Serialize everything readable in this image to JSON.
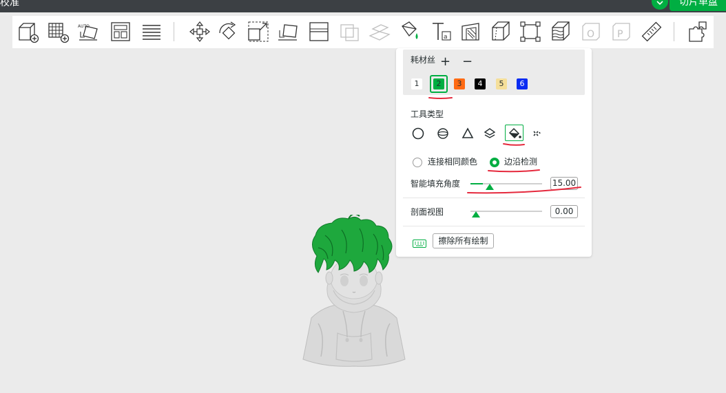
{
  "titlebar": {
    "title": "校准",
    "slice_button": "切片单盘"
  },
  "toolbar": {
    "icons": [
      "add-object-icon",
      "add-plate-icon",
      "auto-orient-icon",
      "arrange-icon",
      "layers-list-icon",
      "move-icon",
      "rotate-icon",
      "scale-icon",
      "lay-on-face-icon",
      "split-icon",
      "cut-icon",
      "boolean-icon",
      "color-paint-icon",
      "text-icon",
      "emboss-icon",
      "cut-plane-icon",
      "fit-bounds-icon",
      "variable-layer-icon",
      "object-label-icon",
      "part-label-icon",
      "measure-icon",
      "assembly-icon"
    ]
  },
  "paint_panel": {
    "filament_label": "耗材丝",
    "add_symbol": "+",
    "remove_symbol": "−",
    "filaments": [
      {
        "label": "1",
        "color": "#ffffff",
        "text_color": "#262e30"
      },
      {
        "label": "2",
        "color": "#00ae42",
        "text_color": "#262e30",
        "selected": true
      },
      {
        "label": "3",
        "color": "#ff6a13",
        "text_color": "#262e30"
      },
      {
        "label": "4",
        "color": "#000000",
        "text_color": "#ffffff"
      },
      {
        "label": "5",
        "color": "#f5df9a",
        "text_color": "#262e30"
      },
      {
        "label": "6",
        "color": "#0a2cf2",
        "text_color": "#ffffff"
      }
    ],
    "tool_type_label": "工具类型",
    "tools": [
      {
        "icon": "circle-brush-icon"
      },
      {
        "icon": "sphere-brush-icon"
      },
      {
        "icon": "triangle-brush-icon"
      },
      {
        "icon": "height-range-icon"
      },
      {
        "icon": "fill-bucket-icon",
        "selected": true
      },
      {
        "icon": "gap-fill-icon"
      }
    ],
    "connect_same_color_label": "连接相同颜色",
    "edge_detection_label": "边沿检测",
    "edge_detection_selected": true,
    "smart_fill_angle_label": "智能填充角度",
    "smart_fill_angle_value": "15.00",
    "smart_fill_angle_level": 0.17,
    "section_view_label": "剖面视图",
    "section_view_value": "0.00",
    "section_view_level": 0.0,
    "keyboard_icon": "keyboard-icon",
    "erase_all_label": "擦除所有绘制"
  },
  "colors": {
    "accent": "#00ae42",
    "annotation": "#e5283c"
  }
}
